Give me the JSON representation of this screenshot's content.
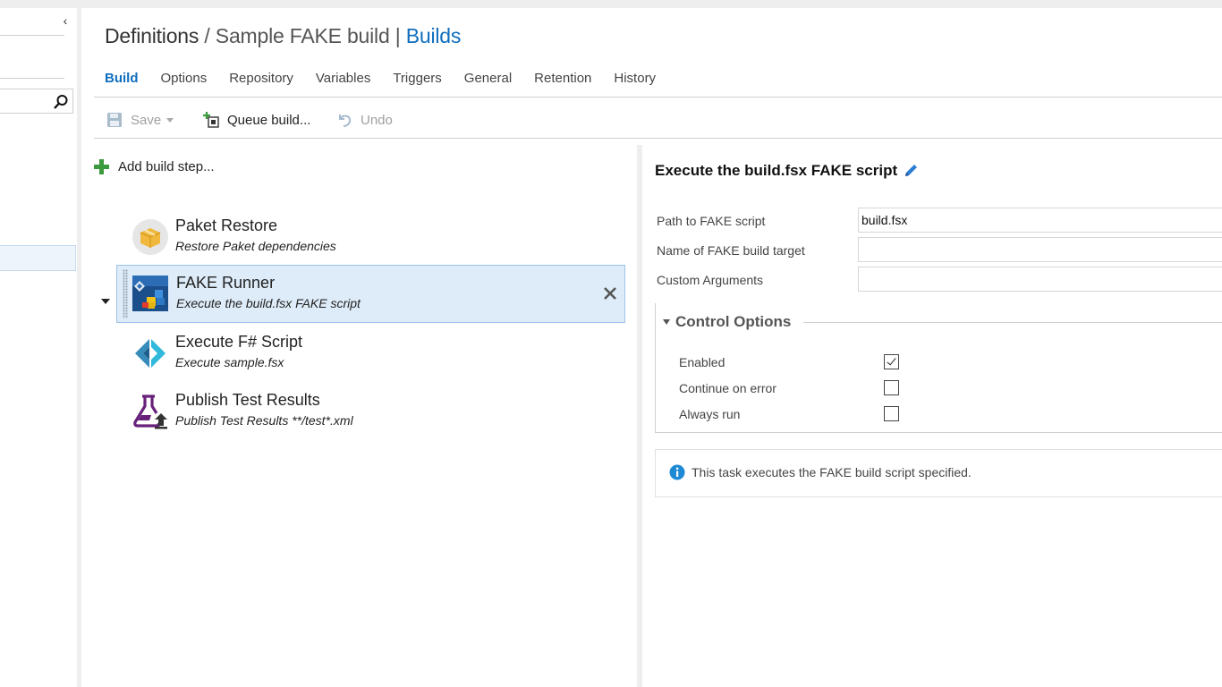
{
  "header": {
    "breadcrumb_root": "Definitions",
    "separator": "/",
    "definition_name": "Sample FAKE build",
    "pipe": "|",
    "builds_link": "Builds"
  },
  "tabs": [
    {
      "label": "Build",
      "active": true
    },
    {
      "label": "Options"
    },
    {
      "label": "Repository"
    },
    {
      "label": "Variables"
    },
    {
      "label": "Triggers"
    },
    {
      "label": "General"
    },
    {
      "label": "Retention"
    },
    {
      "label": "History"
    }
  ],
  "toolbar": {
    "save_label": "Save",
    "queue_label": "Queue build...",
    "undo_label": "Undo"
  },
  "steps_pane": {
    "add_label": "Add build step...",
    "steps": [
      {
        "name": "Paket Restore",
        "description": "Restore Paket dependencies",
        "icon": "package-icon"
      },
      {
        "name": "FAKE Runner",
        "description": "Execute the build.fsx FAKE script",
        "icon": "fake-runner-icon",
        "selected": true
      },
      {
        "name": "Execute F# Script",
        "description": "Execute sample.fsx",
        "icon": "fsharp-icon"
      },
      {
        "name": "Publish Test Results",
        "description": "Publish Test Results **/test*.xml",
        "icon": "flask-upload-icon"
      }
    ]
  },
  "detail": {
    "title": "Execute the build.fsx FAKE script",
    "fields": [
      {
        "label": "Path to FAKE script",
        "value": "build.fsx"
      },
      {
        "label": "Name of FAKE build target",
        "value": ""
      },
      {
        "label": "Custom Arguments",
        "value": ""
      }
    ],
    "control_options": {
      "heading": "Control Options",
      "options": [
        {
          "label": "Enabled",
          "checked": true
        },
        {
          "label": "Continue on error",
          "checked": false
        },
        {
          "label": "Always run",
          "checked": false
        }
      ]
    },
    "info_text": "This task executes the FAKE build script specified."
  },
  "colors": {
    "accent": "#106ebe",
    "selected_row": "#deecf9",
    "add_green": "#3b9a3b",
    "fsharp_blue": "#378bba",
    "flask_purple": "#68217a"
  }
}
